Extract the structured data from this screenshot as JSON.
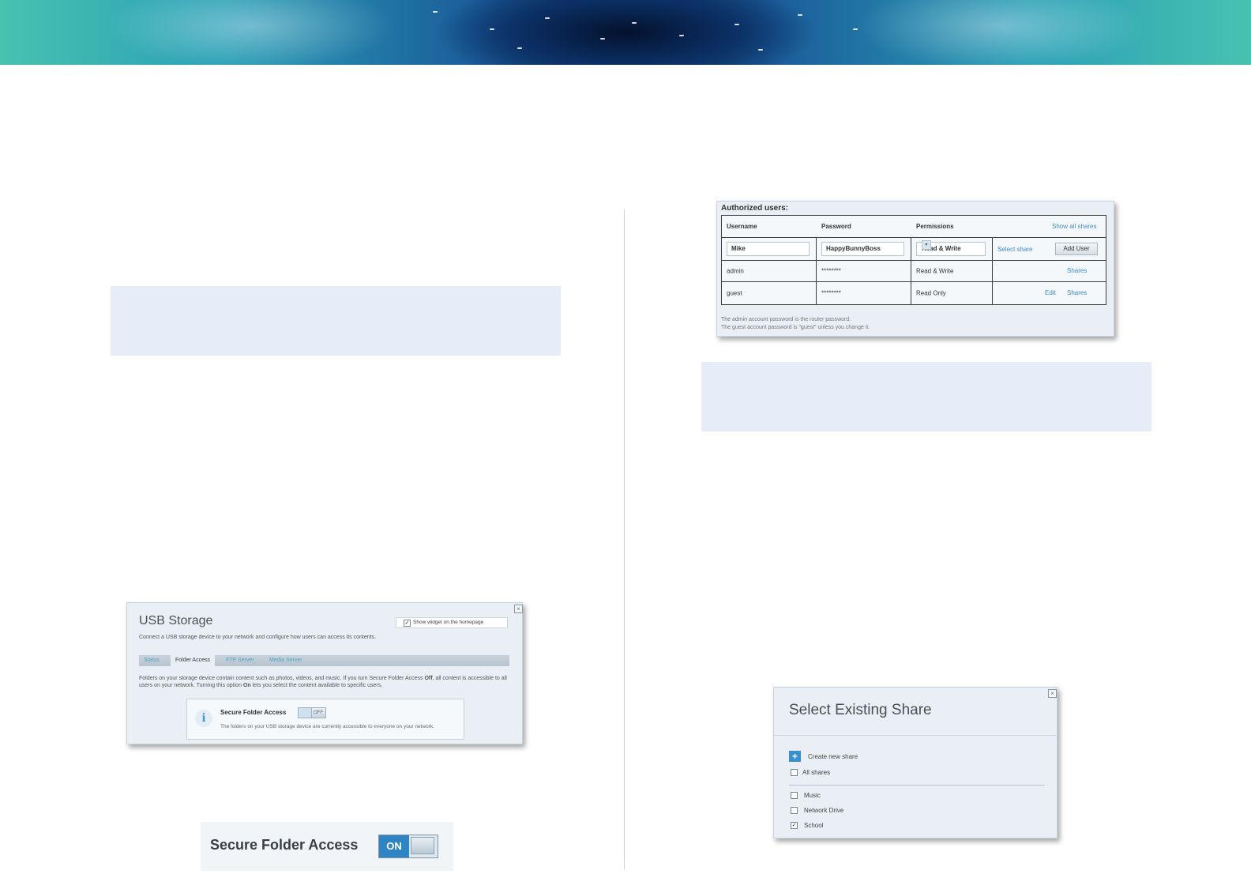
{
  "authorized_users": {
    "title": "Authorized users:",
    "columns": {
      "username": "Username",
      "password": "Password",
      "permissions": "Permissions",
      "show_all": "Show all shares"
    },
    "new_user": {
      "username": "Mike",
      "password": "HappyBunnyBoss",
      "permission": "Read & Write",
      "select_share": "Select share",
      "add_button": "Add User"
    },
    "rows": [
      {
        "username": "admin",
        "password": "********",
        "permission": "Read & Write",
        "actions": [
          "Shares"
        ]
      },
      {
        "username": "guest",
        "password": "********",
        "permission": "Read Only",
        "actions": [
          "Edit",
          "Shares"
        ]
      }
    ],
    "notes": [
      "The admin account password is the router password.",
      "The guest account password is \"guest\" unless you change it."
    ]
  },
  "usb_storage": {
    "title": "USB Storage",
    "subtitle": "Connect a USB storage device to your network and configure how users can access its contents.",
    "show_widget": "Show widget on the homepage",
    "tabs": [
      "Status",
      "Folder Access",
      "FTP Server",
      "Media Server"
    ],
    "active_tab": "Folder Access",
    "description_1": "Folders on your storage device contain content such as photos, videos, and music. If you turn Secure Folder Access ",
    "desc_off": "Off",
    "description_2": ", all content is accessible to all users on your network. Turning this option ",
    "desc_on": "On",
    "description_3": " lets you select the content available to specific users.",
    "secure_folder_access": {
      "title": "Secure Folder Access",
      "toggle": "OFF",
      "text": "The folders on your USB storage device are currently accessible to everyone on your network."
    }
  },
  "secure_folder_on": {
    "title": "Secure Folder Access",
    "toggle": "ON"
  },
  "select_share": {
    "title": "Select Existing Share",
    "create": "Create new share",
    "all_shares": "All shares",
    "items": [
      {
        "label": "Music",
        "checked": false
      },
      {
        "label": "Network Drive",
        "checked": false
      },
      {
        "label": "School",
        "checked": true
      }
    ]
  },
  "colors": {
    "link": "#3c8cc8",
    "note_bg": "#e7edf8",
    "toggle_on": "#2f84c4"
  }
}
